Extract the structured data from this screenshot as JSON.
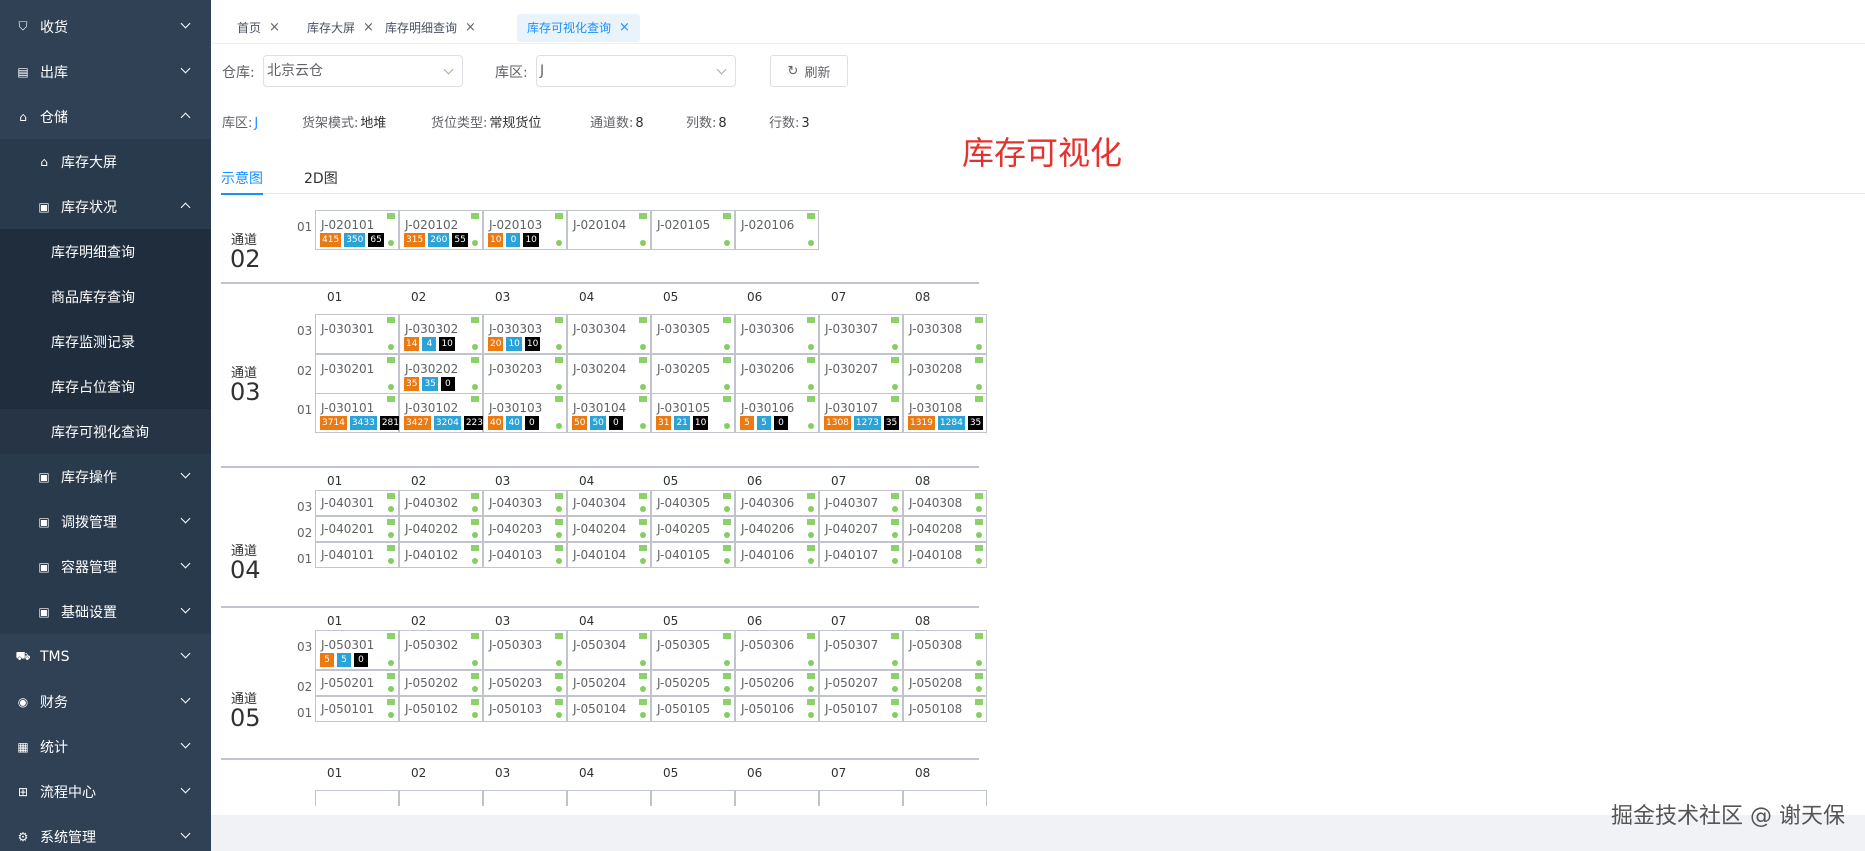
{
  "sidebar": {
    "items": [
      {
        "key": "shouhuo",
        "label": "收货",
        "icon": "receive-icon",
        "level": 0,
        "arrow": "down"
      },
      {
        "key": "chuku",
        "label": "出库",
        "icon": "outbound-icon",
        "level": 0,
        "arrow": "down"
      },
      {
        "key": "cangchu",
        "label": "仓储",
        "icon": "home-icon",
        "level": 0,
        "arrow": "up"
      },
      {
        "key": "kucundaping",
        "label": "库存大屏",
        "icon": "home-icon",
        "level": 1
      },
      {
        "key": "kucunzhuangkuang",
        "label": "库存状况",
        "icon": "grid-icon",
        "level": 1,
        "arrow": "up"
      },
      {
        "key": "kucunmingxi",
        "label": "库存明细查询",
        "level": 2
      },
      {
        "key": "shangpinkucun",
        "label": "商品库存查询",
        "level": 2
      },
      {
        "key": "kucunjiance",
        "label": "库存监测记录",
        "level": 2
      },
      {
        "key": "kucunzhanwei",
        "label": "库存占位查询",
        "level": 2
      },
      {
        "key": "kucunkeshihua",
        "label": "库存可视化查询",
        "level": 2,
        "active": true
      },
      {
        "key": "kucuncaozuo",
        "label": "库存操作",
        "icon": "grid-icon",
        "level": 1,
        "arrow": "down"
      },
      {
        "key": "diaobo",
        "label": "调拨管理",
        "icon": "grid-icon",
        "level": 1,
        "arrow": "down"
      },
      {
        "key": "rongqi",
        "label": "容器管理",
        "icon": "grid-icon",
        "level": 1,
        "arrow": "down"
      },
      {
        "key": "jichu",
        "label": "基础设置",
        "icon": "grid-icon",
        "level": 1,
        "arrow": "down"
      },
      {
        "key": "tms",
        "label": "TMS",
        "icon": "truck-icon",
        "level": 0,
        "arrow": "down"
      },
      {
        "key": "caiwu",
        "label": "财务",
        "icon": "finance-icon",
        "level": 0,
        "arrow": "down"
      },
      {
        "key": "tongji",
        "label": "统计",
        "icon": "stats-icon",
        "level": 0,
        "arrow": "down"
      },
      {
        "key": "liucheng",
        "label": "流程中心",
        "icon": "flow-icon",
        "level": 0,
        "arrow": "down"
      },
      {
        "key": "xitong",
        "label": "系统管理",
        "icon": "settings-icon",
        "level": 0,
        "arrow": "down"
      }
    ]
  },
  "tags": [
    {
      "label": "首页",
      "close": "×"
    },
    {
      "label": "库存大屏",
      "close": "×"
    },
    {
      "label": "库存明细查询",
      "close": "×"
    },
    {
      "label": "库存可视化查询",
      "close": "×",
      "active": true
    }
  ],
  "filters": {
    "warehouse_label": "仓库:",
    "warehouse_value": "北京云仓",
    "zone_label": "库区:",
    "zone_value": "J",
    "refresh_label": "刷新"
  },
  "info": {
    "zone_label": "库区:",
    "zone_value": "J",
    "shelf_label": "货架模式:",
    "shelf_value": "地堆",
    "loc_label": "货位类型:",
    "loc_value": "常规货位",
    "channels_label": "通道数:",
    "channels_value": "8",
    "cols_label": "列数:",
    "cols_value": "8",
    "rows_label": "行数:",
    "rows_value": "3"
  },
  "title": "库存可视化",
  "tabs": [
    {
      "label": "示意图",
      "active": true
    },
    {
      "label": "2D图"
    }
  ],
  "channels": [
    {
      "label": "通道",
      "num": "02",
      "show_cols": false,
      "rows": [
        {
          "row": "01",
          "cells": [
            {
              "id": "J-020101",
              "b": [
                "415",
                "350",
                "65"
              ]
            },
            {
              "id": "J-020102",
              "b": [
                "315",
                "260",
                "55"
              ]
            },
            {
              "id": "J-020103",
              "b": [
                "10",
                "0",
                "10"
              ]
            },
            {
              "id": "J-020104"
            },
            {
              "id": "J-020105"
            },
            {
              "id": "J-020106"
            }
          ]
        }
      ]
    },
    {
      "label": "通道",
      "num": "03",
      "show_cols": true,
      "rows": [
        {
          "row": "03",
          "cells": [
            {
              "id": "J-030301"
            },
            {
              "id": "J-030302",
              "b": [
                "14",
                "4",
                "10"
              ]
            },
            {
              "id": "J-030303",
              "b": [
                "20",
                "10",
                "10"
              ]
            },
            {
              "id": "J-030304"
            },
            {
              "id": "J-030305"
            },
            {
              "id": "J-030306"
            },
            {
              "id": "J-030307"
            },
            {
              "id": "J-030308"
            }
          ]
        },
        {
          "row": "02",
          "cells": [
            {
              "id": "J-030201"
            },
            {
              "id": "J-030202",
              "b": [
                "35",
                "35",
                "0"
              ]
            },
            {
              "id": "J-030203"
            },
            {
              "id": "J-030204"
            },
            {
              "id": "J-030205"
            },
            {
              "id": "J-030206"
            },
            {
              "id": "J-030207"
            },
            {
              "id": "J-030208"
            }
          ]
        },
        {
          "row": "01",
          "cells": [
            {
              "id": "J-030101",
              "b": [
                "3714",
                "3433",
                "281"
              ]
            },
            {
              "id": "J-030102",
              "b": [
                "3427",
                "3204",
                "223"
              ]
            },
            {
              "id": "J-030103",
              "b": [
                "40",
                "40",
                "0"
              ]
            },
            {
              "id": "J-030104",
              "b": [
                "50",
                "50",
                "0"
              ]
            },
            {
              "id": "J-030105",
              "b": [
                "31",
                "21",
                "10"
              ]
            },
            {
              "id": "J-030106",
              "b": [
                "5",
                "5",
                "0"
              ]
            },
            {
              "id": "J-030107",
              "b": [
                "1308",
                "1273",
                "35"
              ]
            },
            {
              "id": "J-030108",
              "b": [
                "1319",
                "1284",
                "35"
              ]
            }
          ]
        }
      ]
    },
    {
      "label": "通道",
      "num": "04",
      "show_cols": true,
      "rows": [
        {
          "row": "03",
          "cells": [
            {
              "id": "J-040301"
            },
            {
              "id": "J-040302"
            },
            {
              "id": "J-040303"
            },
            {
              "id": "J-040304"
            },
            {
              "id": "J-040305"
            },
            {
              "id": "J-040306"
            },
            {
              "id": "J-040307"
            },
            {
              "id": "J-040308"
            }
          ]
        },
        {
          "row": "02",
          "cells": [
            {
              "id": "J-040201"
            },
            {
              "id": "J-040202"
            },
            {
              "id": "J-040203"
            },
            {
              "id": "J-040204"
            },
            {
              "id": "J-040205"
            },
            {
              "id": "J-040206"
            },
            {
              "id": "J-040207"
            },
            {
              "id": "J-040208"
            }
          ]
        },
        {
          "row": "01",
          "cells": [
            {
              "id": "J-040101"
            },
            {
              "id": "J-040102"
            },
            {
              "id": "J-040103"
            },
            {
              "id": "J-040104"
            },
            {
              "id": "J-040105"
            },
            {
              "id": "J-040106"
            },
            {
              "id": "J-040107"
            },
            {
              "id": "J-040108"
            }
          ]
        }
      ]
    },
    {
      "label": "通道",
      "num": "05",
      "show_cols": true,
      "rows": [
        {
          "row": "03",
          "cells": [
            {
              "id": "J-050301",
              "b": [
                "5",
                "5",
                "0"
              ]
            },
            {
              "id": "J-050302"
            },
            {
              "id": "J-050303"
            },
            {
              "id": "J-050304"
            },
            {
              "id": "J-050305"
            },
            {
              "id": "J-050306"
            },
            {
              "id": "J-050307"
            },
            {
              "id": "J-050308"
            }
          ]
        },
        {
          "row": "02",
          "cells": [
            {
              "id": "J-050201"
            },
            {
              "id": "J-050202"
            },
            {
              "id": "J-050203"
            },
            {
              "id": "J-050204"
            },
            {
              "id": "J-050205"
            },
            {
              "id": "J-050206"
            },
            {
              "id": "J-050207"
            },
            {
              "id": "J-050208"
            }
          ]
        },
        {
          "row": "01",
          "cells": [
            {
              "id": "J-050101"
            },
            {
              "id": "J-050102"
            },
            {
              "id": "J-050103"
            },
            {
              "id": "J-050104"
            },
            {
              "id": "J-050105"
            },
            {
              "id": "J-050106"
            },
            {
              "id": "J-050107"
            },
            {
              "id": "J-050108"
            }
          ]
        }
      ]
    },
    {
      "label": "",
      "num": "",
      "show_cols": true,
      "rows": []
    }
  ],
  "col_headers": [
    "01",
    "02",
    "03",
    "04",
    "05",
    "06",
    "07",
    "08"
  ],
  "watermark": "掘金技术社区 @ 谢天保",
  "colors": {
    "sidebar_bg": "#304156",
    "accent": "#1890ff",
    "title": "#e5322d",
    "badge_total": "#ec7a12",
    "badge_available": "#2ba3d9",
    "badge_locked": "#000000"
  }
}
